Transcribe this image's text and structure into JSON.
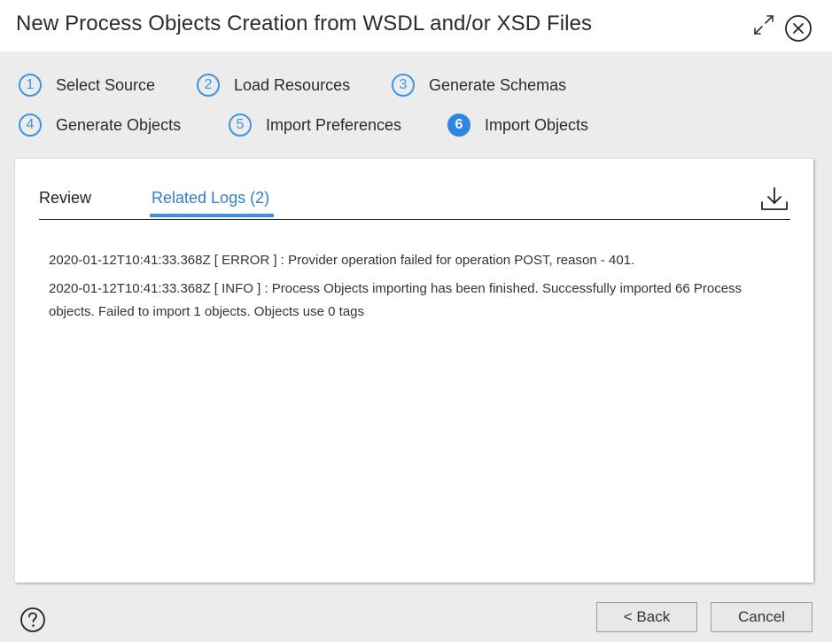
{
  "dialog": {
    "title": "New Process Objects Creation from WSDL and/or XSD Files"
  },
  "icons": {
    "expand": "expand-icon",
    "close": "close-icon",
    "download": "download-icon",
    "help": "help-icon"
  },
  "colors": {
    "accent": "#2f86e0",
    "active_tab": "#2f7fd6"
  },
  "steps": [
    {
      "num": "1",
      "label": "Select Source"
    },
    {
      "num": "2",
      "label": "Load Resources"
    },
    {
      "num": "3",
      "label": "Generate Schemas"
    },
    {
      "num": "4",
      "label": "Generate Objects"
    },
    {
      "num": "5",
      "label": "Import Preferences"
    },
    {
      "num": "6",
      "label": "Import Objects",
      "active": true
    }
  ],
  "tabs": {
    "review": "Review",
    "related_logs": "Related Logs (2)"
  },
  "logs": [
    "2020-01-12T10:41:33.368Z  [ ERROR ] :  Provider operation failed for operation POST, reason - 401.",
    "2020-01-12T10:41:33.368Z  [ INFO ] :  Process Objects importing has been finished. Successfully imported 66 Process objects. Failed to import 1 objects. Objects use 0 tags"
  ],
  "buttons": {
    "back": "< Back",
    "cancel": "Cancel"
  }
}
